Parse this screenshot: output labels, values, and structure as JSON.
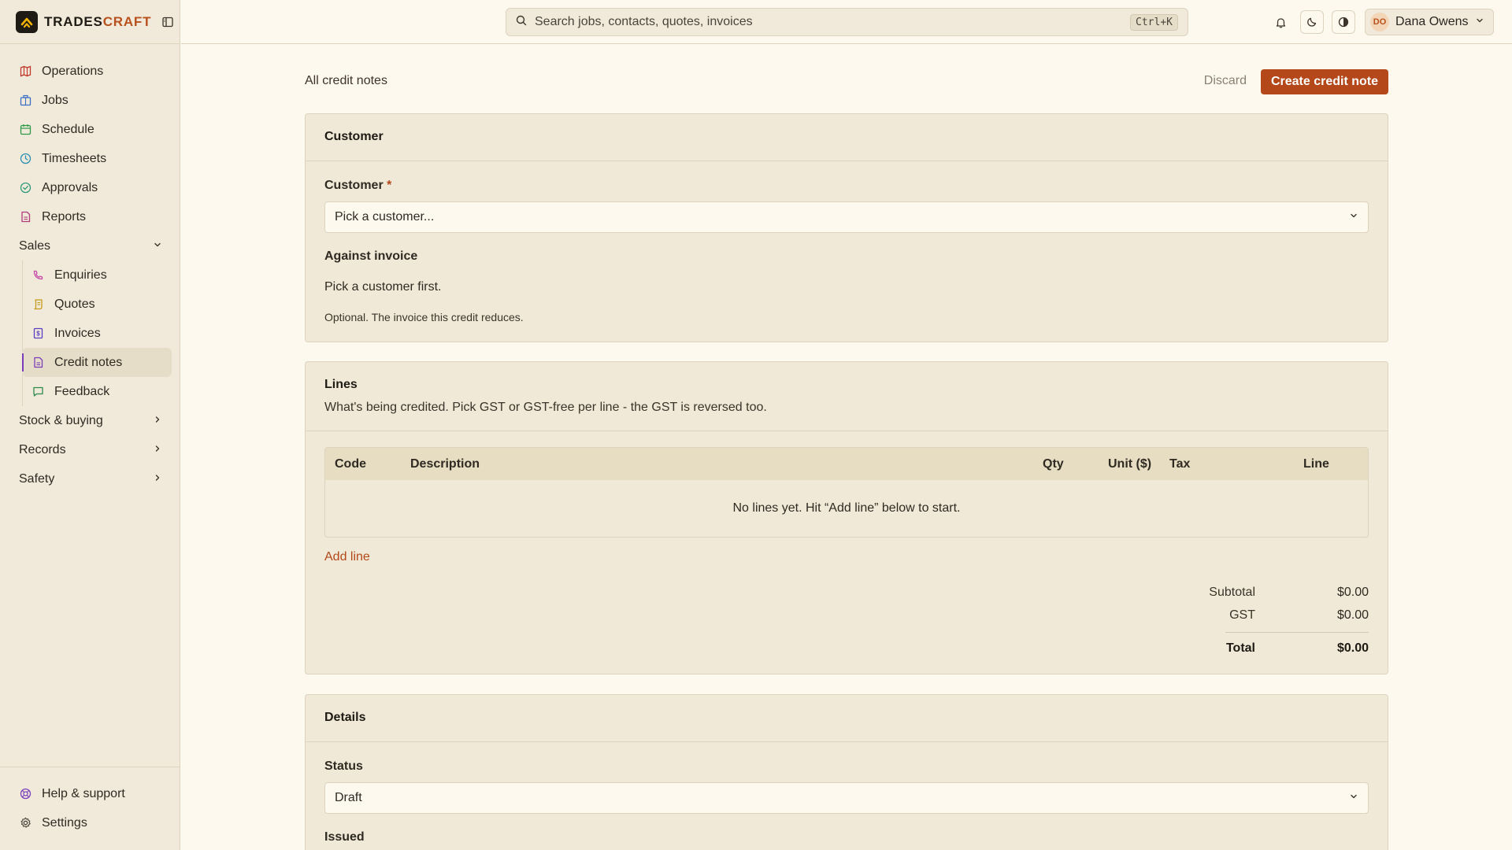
{
  "brand": {
    "name_part1": "TRADES",
    "name_part2": "CRAFT"
  },
  "sidebar": {
    "items": [
      {
        "label": "Operations",
        "icon": "map-icon",
        "color": "#c0392b"
      },
      {
        "label": "Jobs",
        "icon": "building-icon",
        "color": "#3a6fc4"
      },
      {
        "label": "Schedule",
        "icon": "calendar-icon",
        "color": "#2e9a4a"
      },
      {
        "label": "Timesheets",
        "icon": "clock-icon",
        "color": "#2b8fb0"
      },
      {
        "label": "Approvals",
        "icon": "check-circle-icon",
        "color": "#2e9a7a"
      },
      {
        "label": "Reports",
        "icon": "report-icon",
        "color": "#b03a7a"
      }
    ],
    "sales_group": {
      "label": "Sales",
      "items": [
        {
          "label": "Enquiries",
          "icon": "phone-icon",
          "color": "#c44aa8"
        },
        {
          "label": "Quotes",
          "icon": "scroll-icon",
          "color": "#c49a1a"
        },
        {
          "label": "Invoices",
          "icon": "invoice-icon",
          "color": "#5a3fc4"
        },
        {
          "label": "Credit notes",
          "icon": "credit-note-icon",
          "color": "#7a3fb8"
        },
        {
          "label": "Feedback",
          "icon": "message-icon",
          "color": "#2e8a4a"
        }
      ]
    },
    "groups": [
      {
        "label": "Stock & buying"
      },
      {
        "label": "Records"
      },
      {
        "label": "Safety"
      }
    ],
    "bottom": [
      {
        "label": "Help & support",
        "icon": "lifebuoy-icon",
        "color": "#7a3fb8"
      },
      {
        "label": "Settings",
        "icon": "gear-icon",
        "color": "#4a443a"
      }
    ]
  },
  "topbar": {
    "search_placeholder": "Search jobs, contacts, quotes, invoices",
    "search_shortcut": "Ctrl+K",
    "user_initials": "DO",
    "user_name": "Dana Owens"
  },
  "page": {
    "back_label": "All credit notes",
    "discard_label": "Discard",
    "create_label": "Create credit note"
  },
  "customer_card": {
    "title": "Customer",
    "customer_label": "Customer",
    "required_mark": "*",
    "customer_placeholder": "Pick a customer...",
    "against_label": "Against invoice",
    "against_text": "Pick a customer first.",
    "against_hint": "Optional. The invoice this credit reduces."
  },
  "lines_card": {
    "title": "Lines",
    "subtitle": "What's being credited. Pick GST or GST-free per line - the GST is reversed too.",
    "columns": [
      "Code",
      "Description",
      "Qty",
      "Unit ($)",
      "Tax",
      "Line"
    ],
    "empty_text": "No lines yet. Hit “Add line” below to start.",
    "add_line": "Add line",
    "subtotal_label": "Subtotal",
    "subtotal": "$0.00",
    "gst_label": "GST",
    "gst": "$0.00",
    "total_label": "Total",
    "total": "$0.00"
  },
  "details_card": {
    "title": "Details",
    "status_label": "Status",
    "status_value": "Draft",
    "issued_label": "Issued"
  },
  "colors": {
    "accent": "#b4481a",
    "background": "#fdf9ef",
    "sidebar": "#f1eadb",
    "card": "#f0e9d7"
  }
}
